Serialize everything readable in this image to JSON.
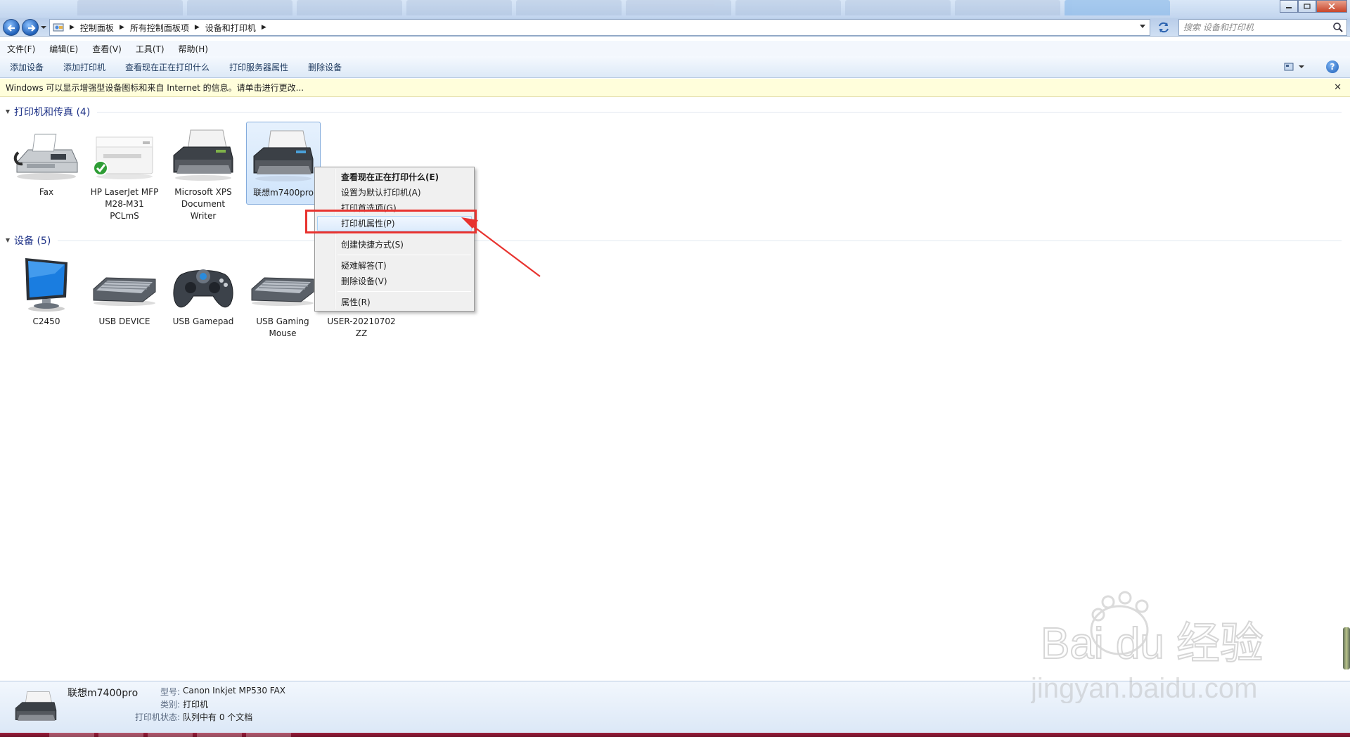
{
  "address_bar": {
    "crumbs": [
      "控制面板",
      "所有控制面板项",
      "设备和打印机"
    ],
    "search_placeholder": "搜索 设备和打印机"
  },
  "menu": [
    "文件(F)",
    "编辑(E)",
    "查看(V)",
    "工具(T)",
    "帮助(H)"
  ],
  "commands": [
    "添加设备",
    "添加打印机",
    "查看现在正在打印什么",
    "打印服务器属性",
    "删除设备"
  ],
  "info_bar": {
    "text": "Windows 可以显示增强型设备图标和来自 Internet 的信息。请单击进行更改..."
  },
  "groups": {
    "printers": {
      "title": "打印机和传真 (4)",
      "items": [
        {
          "name": "Fax"
        },
        {
          "name": "HP LaserJet MFP M28-M31 PCLmS",
          "default_check": true
        },
        {
          "name": "Microsoft XPS Document Writer"
        },
        {
          "name": "联想m7400pro",
          "selected": true
        }
      ]
    },
    "devices": {
      "title": "设备 (5)",
      "items": [
        {
          "name": "C2450"
        },
        {
          "name": "USB DEVICE"
        },
        {
          "name": "USB Gamepad"
        },
        {
          "name": "USB Gaming Mouse"
        },
        {
          "name": "USER-20210702 ZZ"
        }
      ]
    }
  },
  "context_menu": {
    "items": [
      {
        "label": "查看现在正在打印什么(E)",
        "bold": true
      },
      {
        "label": "设置为默认打印机(A)"
      },
      {
        "label": "打印首选项(G)"
      },
      {
        "label": "打印机属性(P)",
        "hover": true
      },
      {
        "label": "创建快捷方式(S)"
      },
      {
        "label": "疑难解答(T)"
      },
      {
        "label": "删除设备(V)"
      },
      {
        "label": "属性(R)"
      }
    ],
    "highlight_color": "#e8332f"
  },
  "details": {
    "name": "联想m7400pro",
    "model_label": "型号:",
    "model_value": "Canon Inkjet MP530 FAX",
    "category_label": "类别:",
    "category_value": "打印机",
    "status_label": "打印机状态:",
    "status_value": "队列中有 0 个文档"
  },
  "watermark": {
    "brand": "Bai du 经验",
    "url": "jingyan.baidu.com"
  },
  "colors": {
    "group_title": "#1e3287",
    "accent_red": "#e8332f",
    "selection": "#cfe4fb"
  }
}
